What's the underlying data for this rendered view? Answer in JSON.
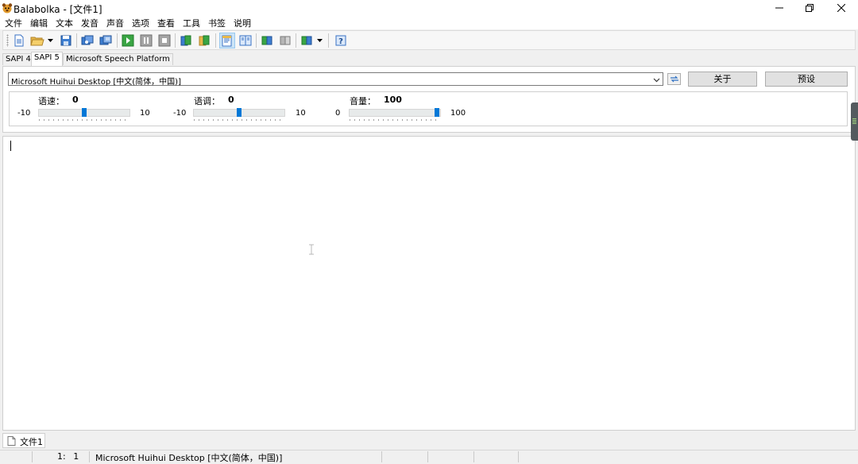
{
  "window": {
    "title": "Balabolka - [文件1]"
  },
  "menu": [
    "文件",
    "编辑",
    "文本",
    "发音",
    "声音",
    "选项",
    "查看",
    "工具",
    "书签",
    "说明"
  ],
  "tabs": [
    "SAPI 4",
    "SAPI 5",
    "Microsoft Speech Platform"
  ],
  "voice": {
    "selected": "Microsoft Huihui Desktop [中文(简体，中国)]",
    "about_label": "关于",
    "preset_label": "预设"
  },
  "sliders": {
    "rate": {
      "label": "语速：",
      "value": "0",
      "min": "-10",
      "max": "10",
      "level": 0.5
    },
    "pitch": {
      "label": "语调：",
      "value": "0",
      "min": "-10",
      "max": "10",
      "level": 0.5
    },
    "volume": {
      "label": "音量：",
      "value": "100",
      "min": "0",
      "max": "100",
      "level": 1.0
    }
  },
  "editor": {
    "text": ""
  },
  "documents": [
    "文件1"
  ],
  "status": {
    "position": "1: 1",
    "voice": "Microsoft Huihui Desktop [中文(简体，中国)]"
  },
  "colors": {
    "accent": "#0078d7",
    "green": "#3aa544"
  }
}
